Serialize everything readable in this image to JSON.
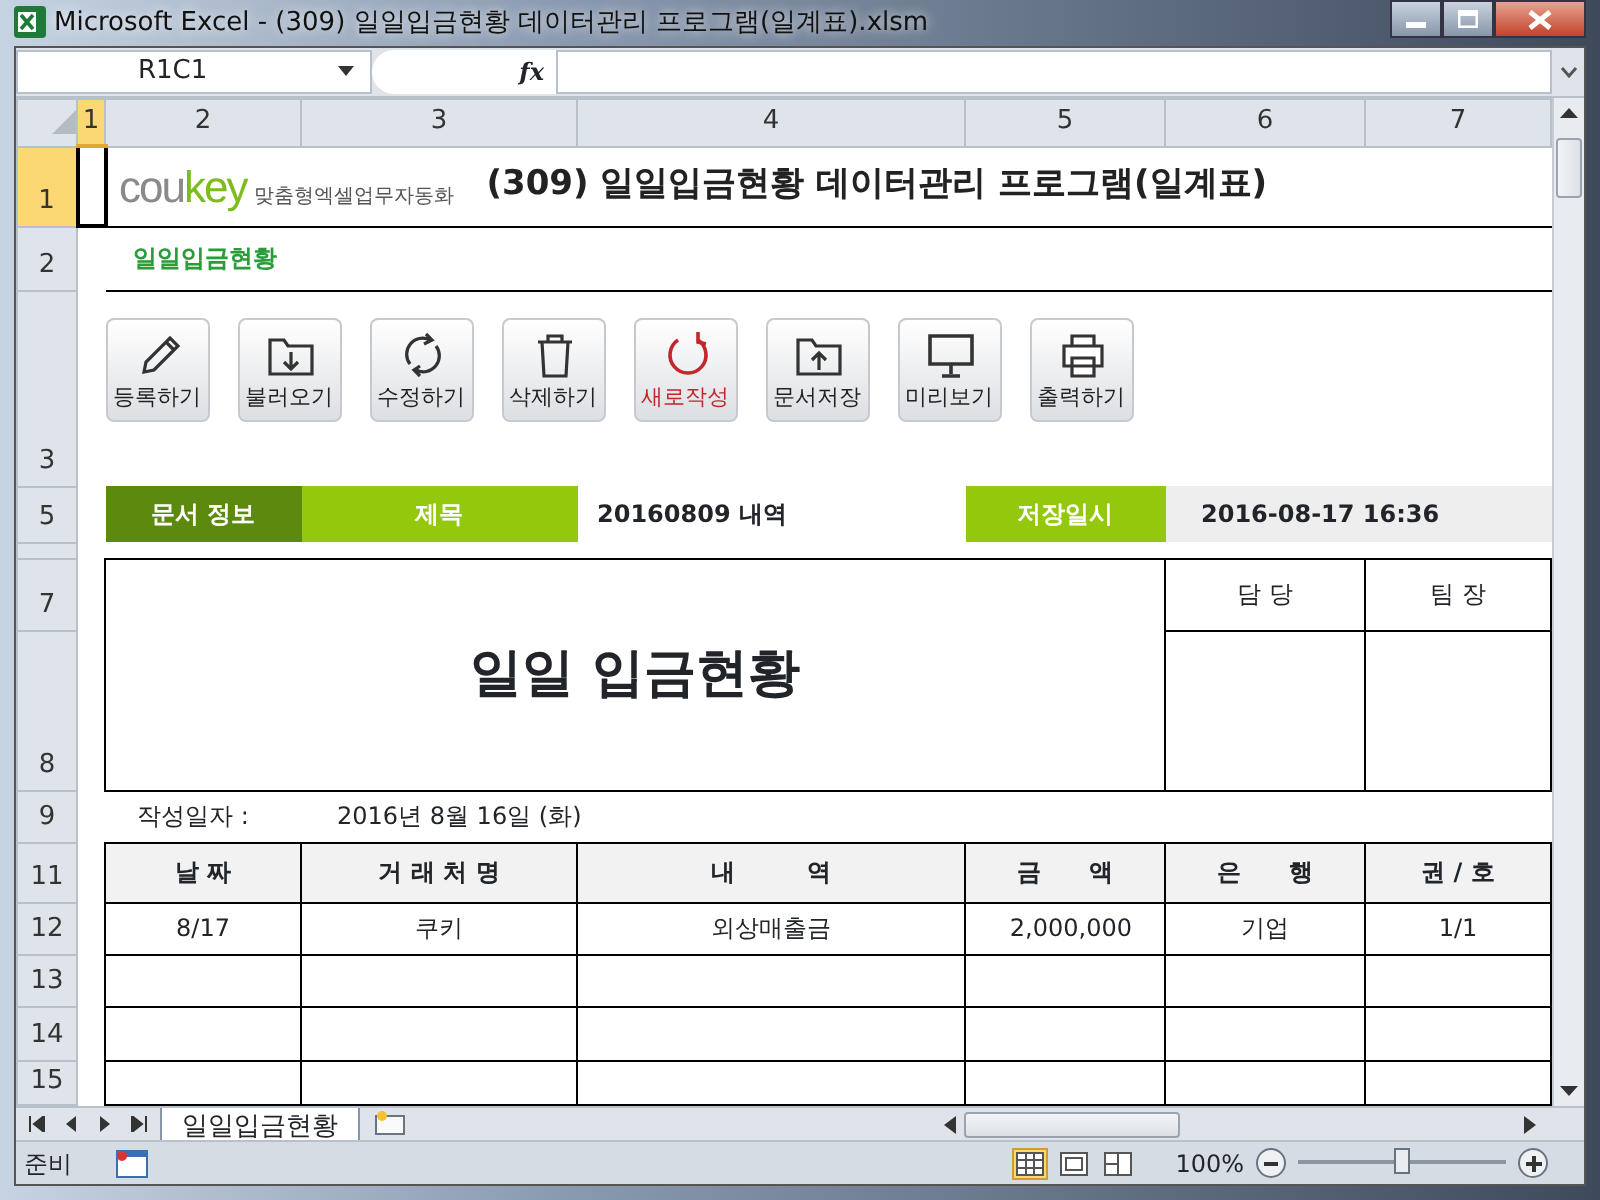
{
  "window": {
    "title": "Microsoft Excel - (309) 일일입금현황 데이터관리 프로그램(일계표).xlsm"
  },
  "name_box": "R1C1",
  "formula_label": "fx",
  "column_headers": [
    {
      "label": "1",
      "selected": true
    },
    {
      "label": "2",
      "selected": false
    },
    {
      "label": "3",
      "selected": false
    },
    {
      "label": "4",
      "selected": false
    },
    {
      "label": "5",
      "selected": false
    },
    {
      "label": "6",
      "selected": false
    },
    {
      "label": "7",
      "selected": false
    }
  ],
  "row_headers": [
    {
      "label": "1",
      "selected": true
    },
    {
      "label": "2",
      "selected": false
    },
    {
      "label": "3",
      "selected": false
    },
    {
      "label": "5",
      "selected": false
    },
    {
      "label": "7",
      "selected": false
    },
    {
      "label": "8",
      "selected": false
    },
    {
      "label": "9",
      "selected": false
    },
    {
      "label": "11",
      "selected": false
    },
    {
      "label": "12",
      "selected": false
    },
    {
      "label": "13",
      "selected": false
    },
    {
      "label": "14",
      "selected": false
    },
    {
      "label": "15",
      "selected": false
    }
  ],
  "sheet": {
    "logo": {
      "brand_gray": "cou",
      "brand_green": "key",
      "tagline": "맞춤형엑셀업무자동화"
    },
    "title": "(309) 일일입금현황 데이터관리 프로그램(일계표)",
    "subtitle": "일일입금현황",
    "buttons": [
      {
        "label": "등록하기",
        "highlight": false
      },
      {
        "label": "불러오기",
        "highlight": false
      },
      {
        "label": "수정하기",
        "highlight": false
      },
      {
        "label": "삭제하기",
        "highlight": false
      },
      {
        "label": "새로작성",
        "highlight": true
      },
      {
        "label": "문서저장",
        "highlight": false
      },
      {
        "label": "미리보기",
        "highlight": false
      },
      {
        "label": "출력하기",
        "highlight": false
      }
    ],
    "info_bar": {
      "doc_info_label": "문서 정보",
      "title_label": "제목",
      "title_value": "20160809 내역",
      "saved_label": "저장일시",
      "saved_value": "2016-08-17 16:36"
    },
    "report": {
      "heading": "일일 입금현황",
      "approvals": [
        "담 당",
        "팀 장"
      ],
      "date_label": "작성일자 :",
      "date_value": "2016년 8월 16일 (화)"
    },
    "table": {
      "columns": [
        "날 짜",
        "거 래 처 명",
        "내　　　역",
        "금　　액",
        "은　　행",
        "권 / 호"
      ],
      "rows": [
        [
          "8/17",
          "쿠키",
          "외상매출금",
          "2,000,000",
          "기업",
          "1/1"
        ]
      ]
    }
  },
  "sheet_tabs": [
    {
      "label": "일일입금현황",
      "selected": true
    }
  ],
  "status_bar": {
    "mode": "준비",
    "zoom": "100%",
    "views": [
      {
        "kind": "normal",
        "selected": true
      },
      {
        "kind": "layout",
        "selected": false
      },
      {
        "kind": "break",
        "selected": false
      }
    ],
    "zoom_slider": {
      "level": 0.5
    }
  }
}
